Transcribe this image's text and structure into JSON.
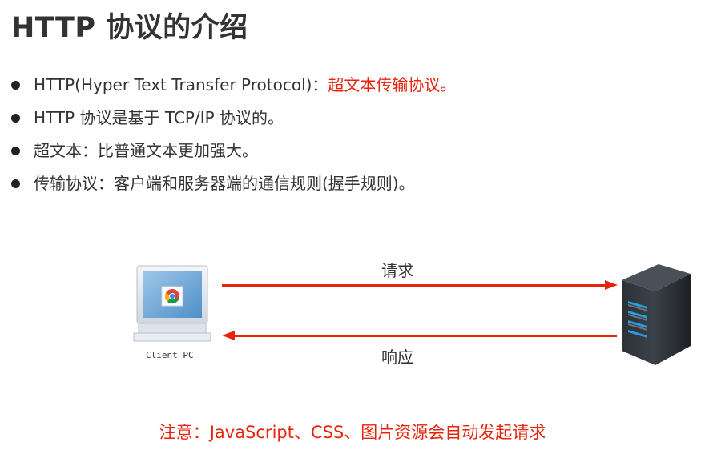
{
  "title": "HTTP 协议的介绍",
  "bullets": [
    {
      "text": "HTTP(Hyper Text Transfer Protocol)：",
      "highlight": "超文本传输协议。"
    },
    {
      "text": "HTTP 协议是基于 TCP/IP 协议的。"
    },
    {
      "text": "超文本：比普通文本更加强大。"
    },
    {
      "text": "传输协议：客户端和服务器端的通信规则(握手规则)。"
    }
  ],
  "diagram": {
    "client_label": "Client PC",
    "request_label": "请求",
    "response_label": "响应",
    "client_icon": "client-pc-browser-icon",
    "server_icon": "server-tower-icon",
    "arrow_color": "#e8230c"
  },
  "note": "注意：JavaScript、CSS、图片资源会自动发起请求",
  "colors": {
    "accent": "#e8230c",
    "text": "#333333"
  }
}
